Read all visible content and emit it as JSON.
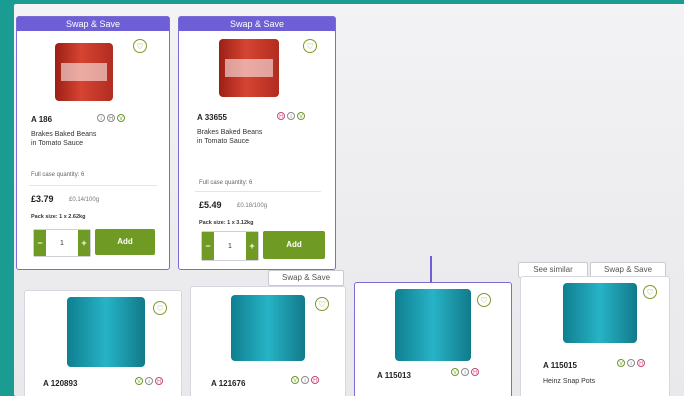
{
  "cards": [
    {
      "banner": "Swap & Save",
      "code": "A 186",
      "name_line1": "Brakes Baked Beans",
      "name_line2": "in Tomato Sauce",
      "case_qty": "Full case quantity: 6",
      "price": "£3.79",
      "unit_price": "£0.14/100g",
      "pack_size": "Pack size: 1 x 2.62kg",
      "quantity": "1",
      "add_label": "Add",
      "minus": "−",
      "plus": "+"
    },
    {
      "banner": "Swap & Save",
      "code": "A 33655",
      "name_line1": "Brakes Baked Beans",
      "name_line2": "in Tomato Sauce",
      "case_qty": "Full case quantity: 6",
      "price": "£5.49",
      "unit_price": "£0.18/100g",
      "pack_size": "Pack size: 1 x 3.12kg",
      "quantity": "1",
      "add_label": "Add",
      "minus": "−",
      "plus": "+"
    }
  ],
  "bottom_cards": [
    {
      "code": "A 120893"
    },
    {
      "code": "A 121676",
      "tag": "Swap & Save"
    },
    {
      "code": "A 115013"
    },
    {
      "code": "A 115015",
      "name": "Heinz Snap Pots",
      "tag_see_similar": "See similar",
      "tag_swap": "Swap & Save"
    }
  ],
  "icon_glyphs": {
    "heart": "♡",
    "vegetarian": "V",
    "halal": "H",
    "info": "i"
  },
  "colors": {
    "accent_purple": "#6f5fd6",
    "add_green": "#6f9a24",
    "background_teal": "#1a9c93"
  }
}
